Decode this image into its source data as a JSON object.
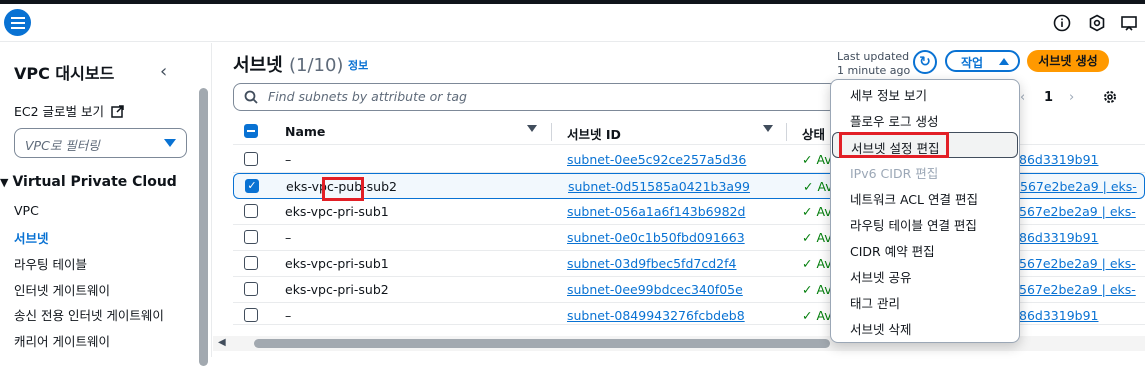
{
  "topbar": {
    "menu_icon": "hamburger-icon",
    "icons": [
      "info-icon",
      "hexagon-settings-icon",
      "cast-icon"
    ]
  },
  "sidebar": {
    "title": "VPC 대시보드",
    "ec2_link": "EC2 글로벌 보기",
    "filter_placeholder": "VPC로 필터링",
    "section": "Virtual Private Cloud",
    "items": [
      {
        "label": "VPC",
        "active": false
      },
      {
        "label": "서브넷",
        "active": true
      },
      {
        "label": "라우팅 테이블",
        "active": false
      },
      {
        "label": "인터넷 게이트웨이",
        "active": false
      },
      {
        "label": "송신 전용 인터넷 게이트웨이",
        "active": false
      },
      {
        "label": "캐리어 게이트웨이",
        "active": false
      }
    ]
  },
  "header": {
    "title": "서브넷",
    "count": "(1/10)",
    "info": "정보",
    "last_updated_line1": "Last updated",
    "last_updated_line2": "1 minute ago",
    "actions_label": "작업",
    "create_label": "서브넷 생성",
    "search_placeholder": "Find subnets by attribute or tag",
    "page_number": "1"
  },
  "table": {
    "columns": [
      "Name",
      "서브넷 ID",
      "상태"
    ],
    "rows": [
      {
        "name": "–",
        "id": "subnet-0ee5c92ce257a5d36",
        "state": "Av",
        "rt": "86d3319b91",
        "selected": false
      },
      {
        "name": "eks-vpc-pub-sub2",
        "id": "subnet-0d51585a0421b3a99",
        "state": "Av",
        "rt": "567e2be2a9 | eks-",
        "selected": true
      },
      {
        "name": "eks-vpc-pri-sub1",
        "id": "subnet-056a1a6f143b6982d",
        "state": "Av",
        "rt": "567e2be2a9 | eks-",
        "selected": false
      },
      {
        "name": "–",
        "id": "subnet-0e0c1b50fbd091663",
        "state": "Av",
        "rt": "86d3319b91",
        "selected": false
      },
      {
        "name": "eks-vpc-pri-sub1",
        "id": "subnet-03d9fbec5fd7cd2f4",
        "state": "Av",
        "rt": "567e2be2a9 | eks-",
        "selected": false
      },
      {
        "name": "eks-vpc-pri-sub2",
        "id": "subnet-0ee99bdcec340f05e",
        "state": "Av",
        "rt": "567e2be2a9 | eks-",
        "selected": false
      },
      {
        "name": "–",
        "id": "subnet-0849943276fcbdeb8",
        "state": "Av",
        "rt": "86d3319b91",
        "selected": false
      }
    ]
  },
  "dropdown": {
    "items": [
      {
        "label": "세부 정보 보기",
        "disabled": false
      },
      {
        "label": "플로우 로그 생성",
        "disabled": false
      },
      {
        "label": "서브넷 설정 편집",
        "disabled": false
      },
      {
        "label": "IPv6 CIDR 편집",
        "disabled": true
      },
      {
        "label": "네트워크 ACL 연결 편집",
        "disabled": false
      },
      {
        "label": "라우팅 테이블 연결 편집",
        "disabled": false
      },
      {
        "label": "CIDR 예약 편집",
        "disabled": false
      },
      {
        "label": "서브넷 공유",
        "disabled": false
      },
      {
        "label": "태그 관리",
        "disabled": false
      },
      {
        "label": "서브넷 삭제",
        "disabled": false
      }
    ]
  },
  "colors": {
    "accent": "#0972d3",
    "primary_button": "#ff9900",
    "available": "#037f0c",
    "highlight": "#e21f26"
  }
}
